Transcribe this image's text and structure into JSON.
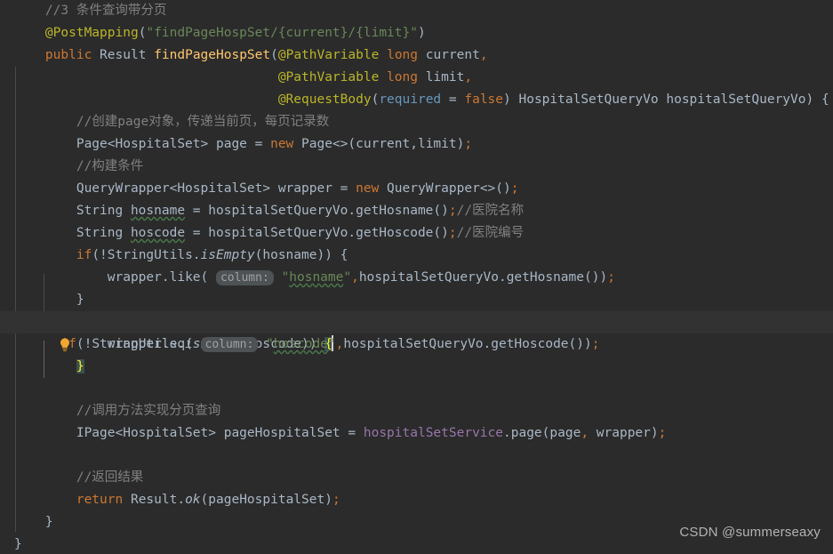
{
  "editor": {
    "theme": "darcula",
    "background": "#2b2b2b",
    "caret_line_background": "#323232",
    "line_height_px": 25,
    "font_size_px": 14.5
  },
  "colors": {
    "default_text": "#a9b7c6",
    "comment": "#808080",
    "keyword": "#cc7832",
    "annotation": "#bbb529",
    "string": "#6a8759",
    "method_declaration": "#ffc66d",
    "field": "#9876aa",
    "number_blue": "#6897bb",
    "inlay_hint_bg": "#4e5254",
    "inlay_hint_text": "#a1a1a1",
    "brace_match_bg": "#3b514d",
    "brace_match_text": "#ffef28",
    "indent_guide": "#4b4b4b",
    "spellcheck_underline": "#49764a",
    "watermark": "#b3b3b3"
  },
  "gutter": {
    "intention_bulb_icon": "lightbulb-icon",
    "bulb_color": "#f0a732",
    "bulb_line_index": 14
  },
  "watermark": {
    "text": "CSDN @summerseaxy"
  },
  "code": {
    "language": "java",
    "lines": [
      "    //3 条件查询带分页",
      "    @PostMapping(\"findPageHospSet/{current}/{limit}\")",
      "    public Result findPageHospSet(@PathVariable long current,",
      "                                  @PathVariable long limit,",
      "                                  @RequestBody(required = false) HospitalSetQueryVo hospitalSetQueryVo) {",
      "        //创建page对象，传递当前页，每页记录数",
      "        Page<HospitalSet> page = new Page<>(current,limit);",
      "        //构建条件",
      "        QueryWrapper<HospitalSet> wrapper = new QueryWrapper<>();",
      "        String hosname = hospitalSetQueryVo.getHosname();//医院名称",
      "        String hoscode = hospitalSetQueryVo.getHoscode();//医院编号",
      "        if(!StringUtils.isEmpty(hosname)) {",
      "            wrapper.like( column: \"hosname\",hospitalSetQueryVo.getHosname());",
      "        }",
      "        if(!StringUtils.isEmpty(hoscode)) {",
      "            wrapper.eq( column: \"hoscode\",hospitalSetQueryVo.getHoscode());",
      "        }",
      "",
      "        //调用方法实现分页查询",
      "        IPage<HospitalSet> pageHospitalSet = hospitalSetService.page(page, wrapper);",
      "",
      "        //返回结果",
      "        return Result.ok(pageHospitalSet);",
      "    }",
      "}"
    ],
    "inlay_hints": [
      {
        "line_index": 12,
        "label": "column:"
      },
      {
        "line_index": 15,
        "label": "column:"
      }
    ],
    "spellchecked_words": [
      "hosname",
      "hoscode"
    ],
    "caret": {
      "line_index": 14,
      "after_token": "{"
    },
    "matched_braces": [
      {
        "line_index": 14,
        "char": "{"
      },
      {
        "line_index": 16,
        "char": "}"
      }
    ]
  }
}
